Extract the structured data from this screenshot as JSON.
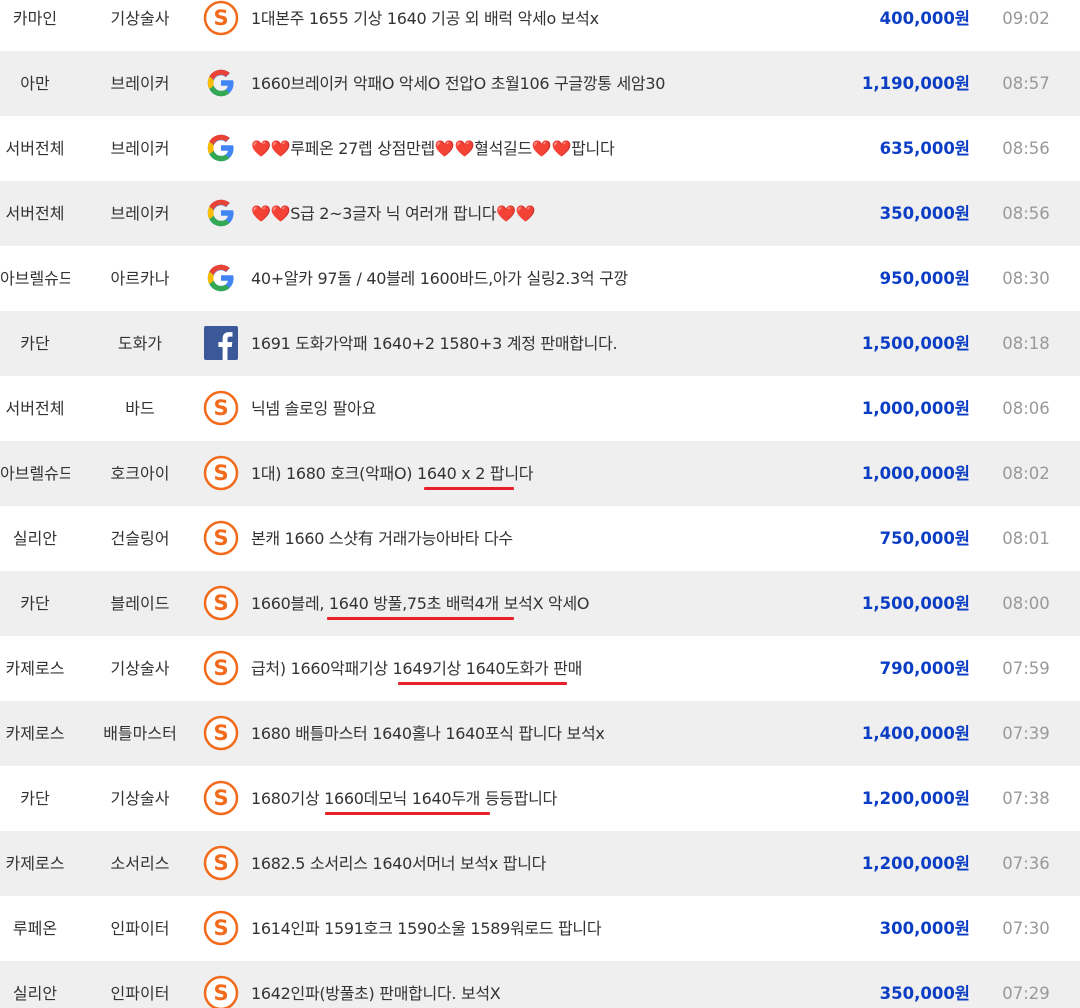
{
  "currency_suffix": "원",
  "colors": {
    "price": "#0b3ec4",
    "time": "#999999",
    "row_alt": "#efefef",
    "underline": "#e8202a",
    "s_icon": "#f26b1d",
    "facebook": "#3b5998"
  },
  "listings": [
    {
      "server": "카마인",
      "class": "기상술사",
      "icon": "s-icon",
      "title": "1대본주 1655 기상 1640 기공 외 배럭 악세o 보석x",
      "price": "400,000원",
      "time": "09:02"
    },
    {
      "server": "아만",
      "class": "브레이커",
      "icon": "google-icon",
      "title": "1660브레이커 악패O 악세O 전압O 초월106 구글깡통 세암30",
      "price": "1,190,000원",
      "time": "08:57"
    },
    {
      "server": "서버전체",
      "class": "브레이커",
      "icon": "google-icon",
      "title": "❤️❤️루페온 27렙 상점만렙❤️❤️혈석길드❤️❤️팝니다",
      "price": "635,000원",
      "time": "08:56"
    },
    {
      "server": "서버전체",
      "class": "브레이커",
      "icon": "google-icon",
      "title": "❤️❤️S급 2~3글자 닉 여러개 팝니다❤️❤️",
      "price": "350,000원",
      "time": "08:56"
    },
    {
      "server": "아브렐슈드",
      "class": "아르카나",
      "icon": "google-icon",
      "title": "40+알카 97돌 / 40블레 1600바드,아가 실링2.3억 구깡",
      "price": "950,000원",
      "time": "08:30"
    },
    {
      "server": "카단",
      "class": "도화가",
      "icon": "facebook-icon",
      "title": "1691 도화가악패 1640+2 1580+3 계정 판매합니다.",
      "price": "1,500,000원",
      "time": "08:18"
    },
    {
      "server": "서버전체",
      "class": "바드",
      "icon": "s-icon",
      "title": "닉넴 솔로잉 팔아요",
      "price": "1,000,000원",
      "time": "08:06"
    },
    {
      "server": "아브렐슈드",
      "class": "호크아이",
      "icon": "s-icon",
      "title": "1대) 1680 호크(악패O) 1640 x 2 팝니다",
      "price": "1,000,000원",
      "time": "08:02"
    },
    {
      "server": "실리안",
      "class": "건슬링어",
      "icon": "s-icon",
      "title": "본캐 1660 스샷有 거래가능아바타 다수",
      "price": "750,000원",
      "time": "08:01"
    },
    {
      "server": "카단",
      "class": "블레이드",
      "icon": "s-icon",
      "title": "1660블레, 1640 방풀,75초 배럭4개 보석X 악세O",
      "price": "1,500,000원",
      "time": "08:00"
    },
    {
      "server": "카제로스",
      "class": "기상술사",
      "icon": "s-icon",
      "title": "급처) 1660악패기상 1649기상 1640도화가 판매",
      "price": "790,000원",
      "time": "07:59"
    },
    {
      "server": "카제로스",
      "class": "배틀마스터",
      "icon": "s-icon",
      "title": "1680 배틀마스터 1640홀나 1640포식 팝니다 보석x",
      "price": "1,400,000원",
      "time": "07:39"
    },
    {
      "server": "카단",
      "class": "기상술사",
      "icon": "s-icon",
      "title": "1680기상 1660데모닉 1640두개 등등팝니다",
      "price": "1,200,000원",
      "time": "07:38"
    },
    {
      "server": "카제로스",
      "class": "소서리스",
      "icon": "s-icon",
      "title": "1682.5 소서리스 1640서머너 보석x 팝니다",
      "price": "1,200,000원",
      "time": "07:36"
    },
    {
      "server": "루페온",
      "class": "인파이터",
      "icon": "s-icon",
      "title": "1614인파 1591호크 1590소울 1589워로드 팝니다",
      "price": "300,000원",
      "time": "07:30"
    },
    {
      "server": "실리안",
      "class": "인파이터",
      "icon": "s-icon",
      "title": "1642인파(방풀초) 판매합니다. 보석X",
      "price": "350,000원",
      "time": "07:29"
    }
  ]
}
